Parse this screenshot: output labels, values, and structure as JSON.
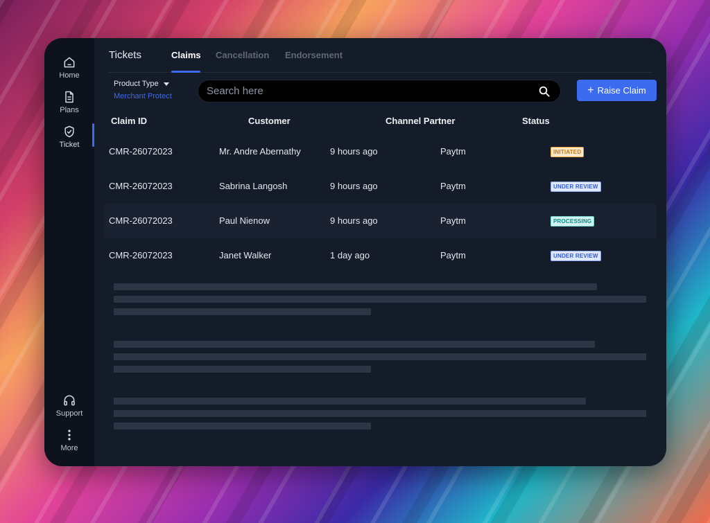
{
  "sidebar": {
    "items": [
      {
        "label": "Home",
        "icon": "home-icon"
      },
      {
        "label": "Plans",
        "icon": "document-icon"
      },
      {
        "label": "Ticket",
        "icon": "shield-check-icon"
      },
      {
        "label": "Support",
        "icon": "headphones-icon"
      },
      {
        "label": "More",
        "icon": "more-vertical-icon"
      }
    ]
  },
  "tabs": {
    "title": "Tickets",
    "items": [
      "Claims",
      "Cancellation",
      "Endorsement"
    ],
    "active": "Claims"
  },
  "filter": {
    "label": "Product Type",
    "value": "Merchant Protect"
  },
  "search": {
    "placeholder": "Search here"
  },
  "actions": {
    "raise_claim": "Raise Claim"
  },
  "table": {
    "headers": [
      "Claim ID",
      "Customer",
      "Channel Partner",
      "Status"
    ],
    "rows": [
      {
        "claim_id": "CMR-26072023",
        "customer": "Mr. Andre Abernathy",
        "time": "9 hours ago",
        "partner": "Paytm",
        "status": "INITIATED"
      },
      {
        "claim_id": "CMR-26072023",
        "customer": "Sabrina Langosh",
        "time": "9 hours ago",
        "partner": "Paytm",
        "status": "UNDER REVIEW"
      },
      {
        "claim_id": "CMR-26072023",
        "customer": "Paul Nienow",
        "time": "9 hours ago",
        "partner": "Paytm",
        "status": "PROCESSING"
      },
      {
        "claim_id": "CMR-26072023",
        "customer": "Janet Walker",
        "time": "1 day ago",
        "partner": "Paytm",
        "status": "UNDER REVIEW"
      }
    ]
  },
  "colors": {
    "accent": "#3d6bf0",
    "panel": "#141b29",
    "sidebar": "#0d121c",
    "status_initiated": "#f0a23a",
    "status_under_review": "#3d6bf0",
    "status_processing": "#1fb5b0"
  }
}
